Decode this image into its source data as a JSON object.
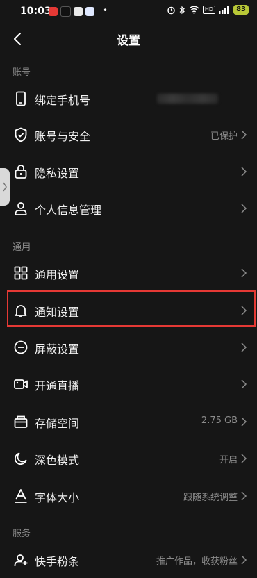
{
  "status_bar": {
    "time": "10:03",
    "dot": "•",
    "hd": "HD",
    "battery": "83"
  },
  "header": {
    "title": "设置"
  },
  "sections": {
    "account": "账号",
    "general": "通用",
    "service": "服务"
  },
  "rows": {
    "bind_phone": {
      "label": "绑定手机号",
      "icon": "phone-icon"
    },
    "account_security": {
      "label": "账号与安全",
      "value": "已保护",
      "icon": "shield-icon"
    },
    "privacy": {
      "label": "隐私设置",
      "icon": "lock-icon"
    },
    "personal_info": {
      "label": "个人信息管理",
      "icon": "person-icon"
    },
    "general_settings": {
      "label": "通用设置",
      "icon": "grid-icon"
    },
    "notification": {
      "label": "通知设置",
      "icon": "bell-icon"
    },
    "block": {
      "label": "屏蔽设置",
      "icon": "block-icon"
    },
    "live": {
      "label": "开通直播",
      "icon": "video-icon"
    },
    "storage": {
      "label": "存储空间",
      "value": "2.75 GB",
      "icon": "storage-icon"
    },
    "dark_mode": {
      "label": "深色模式",
      "value": "开启",
      "icon": "moon-icon"
    },
    "font_size": {
      "label": "字体大小",
      "value": "跟随系统调整",
      "icon": "font-icon"
    },
    "fans": {
      "label": "快手粉条",
      "value": "推广作品，收获粉丝",
      "icon": "fans-icon"
    }
  },
  "colors": {
    "background": "#161616",
    "highlight_border": "#e53935",
    "secondary_text": "#8b8b8b"
  }
}
